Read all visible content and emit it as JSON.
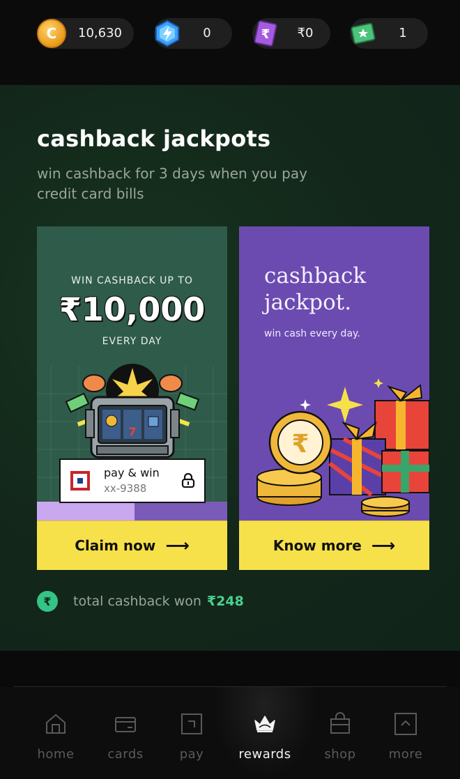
{
  "balances": [
    {
      "icon": "coin-icon",
      "value": "10,630"
    },
    {
      "icon": "gem-icon",
      "value": "0"
    },
    {
      "icon": "cash-voucher-icon",
      "value": "₹0"
    },
    {
      "icon": "ticket-icon",
      "value": "1"
    }
  ],
  "section": {
    "title": "cashback jackpots",
    "subtitle": "win cashback for 3 days when you pay credit card bills"
  },
  "cards": [
    {
      "top_label": "WIN CASHBACK UP TO",
      "amount": "₹10,000",
      "sub_label": "EVERY DAY",
      "pay_win_title": "pay & win",
      "pay_win_number": "xx-9388",
      "cta": "Claim now"
    },
    {
      "title_line1": "cashback",
      "title_line2": "jackpot.",
      "subtitle": "win cash every day.",
      "cta": "Know more"
    }
  ],
  "total_won": {
    "label": "total cashback won",
    "amount": "₹248"
  },
  "nav": [
    {
      "label": "home",
      "icon": "home-icon",
      "active": false
    },
    {
      "label": "cards",
      "icon": "card-icon",
      "active": false
    },
    {
      "label": "pay",
      "icon": "pay-icon",
      "active": false
    },
    {
      "label": "rewards",
      "icon": "crown-icon",
      "active": true
    },
    {
      "label": "shop",
      "icon": "shop-bag-icon",
      "active": false
    },
    {
      "label": "more",
      "icon": "more-icon",
      "active": false
    }
  ],
  "colors": {
    "section_bg": "#132a1d",
    "cta_yellow": "#f7e14a",
    "card1_bg": "#2f5b4a",
    "card2_bg": "#6c4bb0",
    "accent_green": "#4bd18f"
  }
}
